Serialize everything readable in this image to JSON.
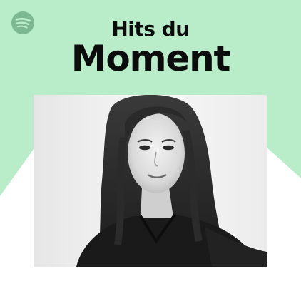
{
  "cover": {
    "title_line1": "Hits du",
    "title_line2": "Moment",
    "logo_icon": "spotify-logo-icon",
    "photo_subject": "portrait",
    "colors": {
      "mint_green": "#b9ecc8",
      "title_text": "#0c0c0c",
      "logo_grey": "#7cb892",
      "background": "#ffffff"
    }
  }
}
